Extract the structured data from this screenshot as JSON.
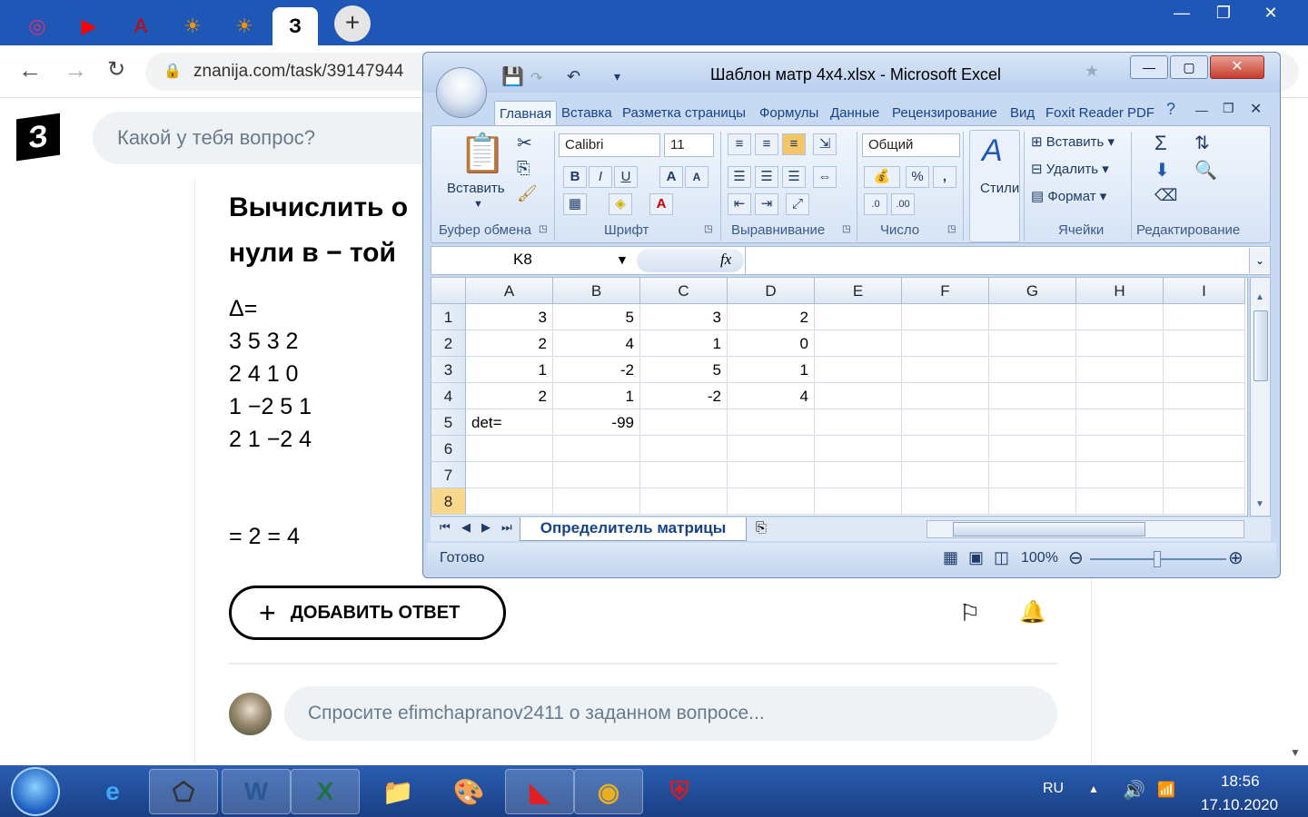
{
  "browser": {
    "tabs": [
      {
        "icon": "instagram-icon",
        "glyph": "◎",
        "color": "#e1306c"
      },
      {
        "icon": "youtube-icon",
        "glyph": "▶",
        "color": "#ff0000"
      },
      {
        "icon": "acrobat-icon",
        "glyph": "A",
        "color": "#d40000"
      },
      {
        "icon": "sun-icon",
        "glyph": "☀",
        "color": "#f29400"
      },
      {
        "icon": "sun-icon",
        "glyph": "☀",
        "color": "#f29400"
      },
      {
        "icon": "znanija-icon",
        "glyph": "З",
        "color": "#000000"
      }
    ],
    "new_tab": "+",
    "url": "znanija.com/task/39147944"
  },
  "site": {
    "logo": "З",
    "search_placeholder": "Какой у тебя вопрос?",
    "question_title_line1": "Вычислить о",
    "question_title_line2": "нули в − той",
    "lines": [
      "Δ=",
      "3 5 3 2",
      "2 4 1 0",
      "1 −2 5 1",
      "2 1 −2 4"
    ],
    "result": "= 2 = 4",
    "add_answer": "ДОБАВИТЬ ОТВЕТ",
    "ask_placeholder": "Спросите efimchapranov2411 о заданном вопросе..."
  },
  "excel": {
    "title": "Шаблон матр 4x4.xlsx - Microsoft Excel",
    "ribbon_tabs": [
      "Главная",
      "Вставка",
      "Разметка страницы",
      "Формулы",
      "Данные",
      "Рецензирование",
      "Вид",
      "Foxit Reader PDF"
    ],
    "groups": {
      "clipboard": "Буфер обмена",
      "font": "Шрифт",
      "align": "Выравнивание",
      "number": "Число",
      "styles": "Стили",
      "cells": "Ячейки",
      "editing": "Редактирование"
    },
    "paste": "Вставить",
    "font_name": "Calibri",
    "font_size": "11",
    "number_format": "Общий",
    "insert": "Вставить",
    "delete": "Удалить",
    "format": "Формат",
    "name_box": "K8",
    "fx": "fx",
    "columns": [
      "A",
      "B",
      "C",
      "D",
      "E",
      "F",
      "G",
      "H",
      "I"
    ],
    "rows": [
      {
        "n": "1",
        "cells": [
          "3",
          "5",
          "3",
          "2"
        ]
      },
      {
        "n": "2",
        "cells": [
          "2",
          "4",
          "1",
          "0"
        ]
      },
      {
        "n": "3",
        "cells": [
          "1",
          "-2",
          "5",
          "1"
        ]
      },
      {
        "n": "4",
        "cells": [
          "2",
          "1",
          "-2",
          "4"
        ]
      },
      {
        "n": "5",
        "cells": [
          "det=",
          "-99",
          "",
          ""
        ]
      },
      {
        "n": "6",
        "cells": [
          "",
          "",
          "",
          ""
        ]
      },
      {
        "n": "7",
        "cells": [
          "",
          "",
          "",
          ""
        ]
      },
      {
        "n": "8",
        "cells": [
          "",
          "",
          "",
          ""
        ]
      }
    ],
    "sheet_name": "Определитель матрицы",
    "status": "Готово",
    "zoom": "100%"
  },
  "taskbar": {
    "lang": "RU",
    "time": "18:56",
    "date": "17.10.2020"
  }
}
